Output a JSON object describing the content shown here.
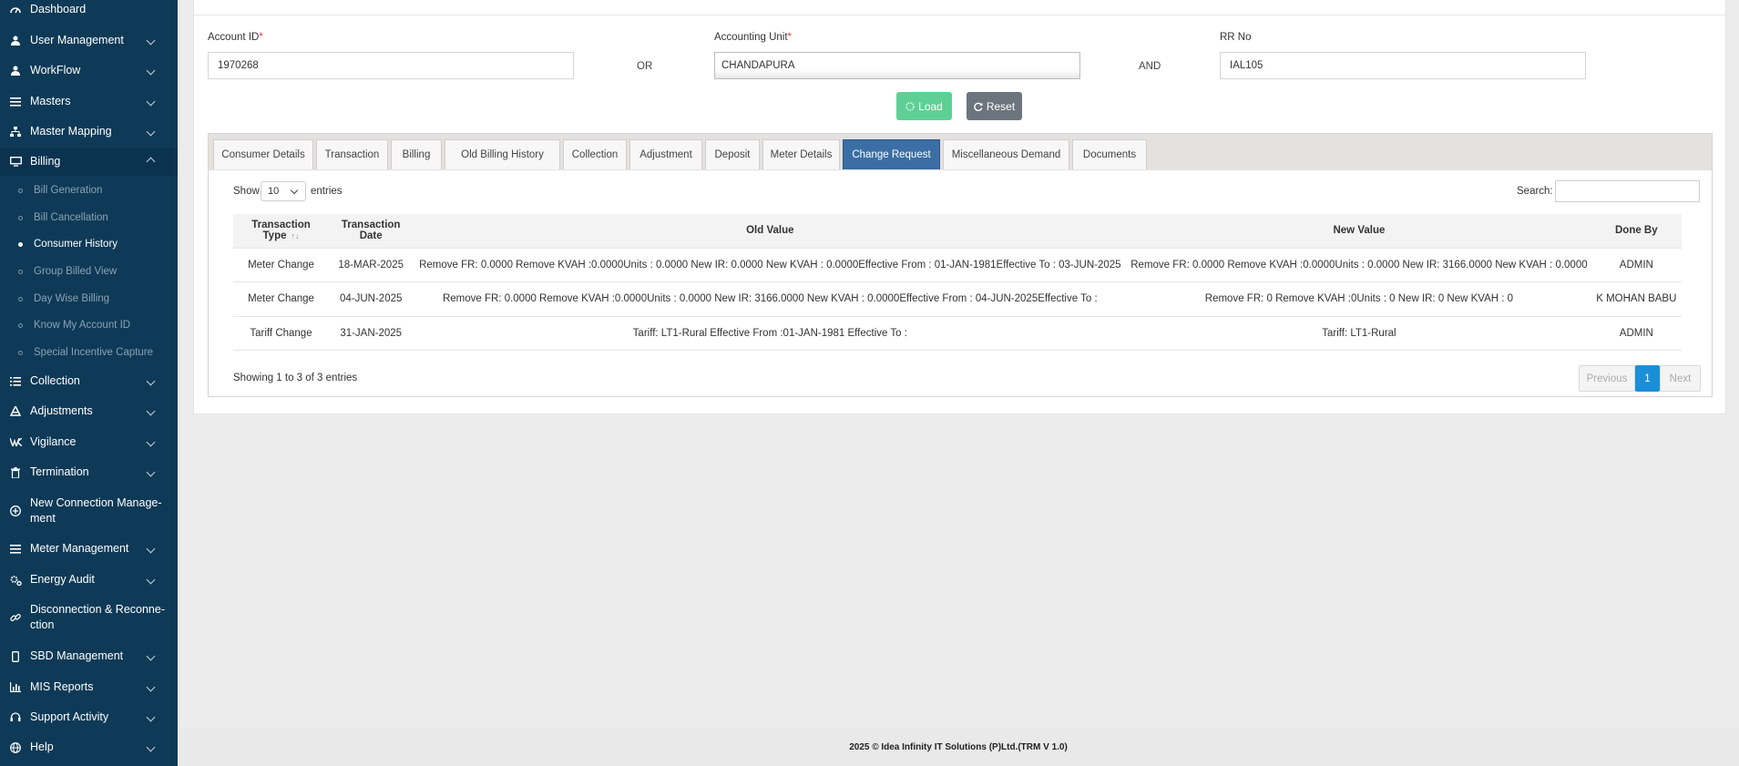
{
  "sidebar": {
    "items": [
      {
        "label": "Dashboard",
        "icon": "dashboard-icon"
      },
      {
        "label": "User Management",
        "icon": "user-icon"
      },
      {
        "label": "WorkFlow",
        "icon": "user-icon"
      },
      {
        "label": "Masters",
        "icon": "list-icon"
      },
      {
        "label": "Master Mapping",
        "icon": "sitemap-icon"
      },
      {
        "label": "Billing",
        "icon": "desktop-icon"
      },
      {
        "label": "Collection",
        "icon": "list-icon"
      },
      {
        "label": "Adjustments",
        "icon": "balance-icon"
      },
      {
        "label": "Vigilance",
        "icon": "vk-icon"
      },
      {
        "label": "Termination",
        "icon": "trash-icon"
      },
      {
        "label": "New Connection Manage-",
        "label2": "ment",
        "icon": "plus-circle-icon"
      },
      {
        "label": "Meter Management",
        "icon": "list-icon"
      },
      {
        "label": "Energy Audit",
        "icon": "gears-icon"
      },
      {
        "label": "Disconnection & Reconne-",
        "label2": "ction",
        "icon": "link-icon"
      },
      {
        "label": "SBD Management",
        "icon": "mobile-icon"
      },
      {
        "label": "MIS Reports",
        "icon": "bar-chart-icon"
      },
      {
        "label": "Support Activity",
        "icon": "headset-icon"
      },
      {
        "label": "Help",
        "icon": "globe-icon"
      }
    ],
    "billing_sub": [
      "Bill Generation",
      "Bill Cancellation",
      "Consumer History",
      "Group Billed View",
      "Day Wise Billing",
      "Know My Account ID",
      "Special Incentive Capture"
    ]
  },
  "form": {
    "account_id_label": "Account ID",
    "account_id_value": "1970268",
    "or_label": "OR",
    "accounting_unit_label": "Accounting Unit",
    "accounting_unit_value": "CHANDAPURA",
    "and_label": "AND",
    "rr_no_label": "RR No",
    "rr_no_value": "IAL105",
    "required_mark": "*",
    "load_label": "Load",
    "reset_label": "Reset"
  },
  "tabs": [
    "Consumer Details",
    "Transaction",
    "Billing",
    "Old Billing History",
    "Collection",
    "Adjustment",
    "Deposit",
    "Meter Details",
    "Change Request",
    "Miscellaneous Demand",
    "Documents"
  ],
  "active_tab": "Change Request",
  "table": {
    "show_label": "Show",
    "entries_value": "10",
    "entries_label": "entries",
    "search_label": "Search:",
    "columns": [
      "Transaction Type",
      "Transaction Date",
      "Old Value",
      "New Value",
      "Done By"
    ],
    "rows": [
      [
        "Meter Change",
        "18-MAR-2025",
        "Remove FR: 0.0000 Remove KVAH :0.0000Units : 0.0000 New IR: 0.0000 New KVAH : 0.0000Effective From : 01-JAN-1981Effective To : 03-JUN-2025",
        "Remove FR: 0.0000 Remove KVAH :0.0000Units : 0.0000 New IR: 3166.0000 New KVAH : 0.0000",
        "ADMIN"
      ],
      [
        "Meter Change",
        "04-JUN-2025",
        "Remove FR: 0.0000 Remove KVAH :0.0000Units : 0.0000 New IR: 3166.0000 New KVAH : 0.0000Effective From : 04-JUN-2025Effective To :",
        "Remove FR: 0 Remove KVAH :0Units : 0 New IR: 0 New KVAH : 0",
        "K MOHAN BABU"
      ],
      [
        "Tariff Change",
        "31-JAN-2025",
        "Tariff: LT1-Rural Effective From :01-JAN-1981 Effective To :",
        "Tariff: LT1-Rural",
        "ADMIN"
      ]
    ],
    "info": "Showing 1 to 3 of 3 entries",
    "prev_label": "Previous",
    "page": "1",
    "next_label": "Next"
  },
  "footer": "2025 © Idea Infinity IT Solutions (P)Ltd.(TRM V 1.0)",
  "colors": {
    "sidebar_bg": "#0e3a57",
    "active_tab": "#3a6ea5",
    "load_btn": "#5fd095",
    "reset_btn": "#6c757d",
    "page_current": "#1a8fd8"
  }
}
